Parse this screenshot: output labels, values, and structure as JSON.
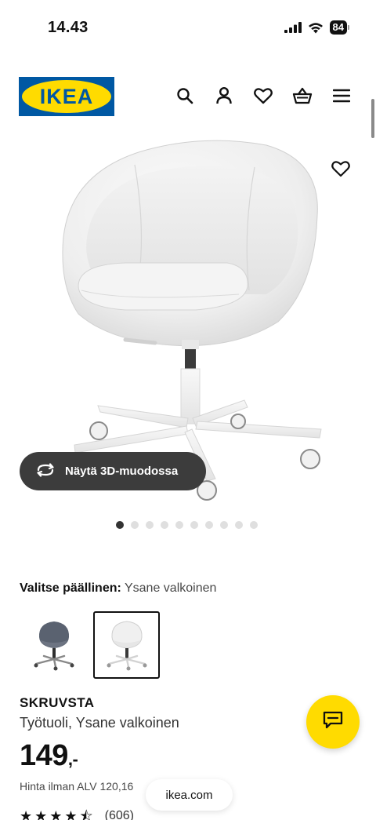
{
  "status_bar": {
    "time": "14.43",
    "battery": "84"
  },
  "header": {
    "logo_text": "IKEA",
    "icons": [
      "search-icon",
      "user-icon",
      "heart-icon",
      "basket-icon",
      "menu-icon"
    ]
  },
  "gallery": {
    "view_3d_label": "Näytä 3D-muodossa",
    "image_count": 10,
    "active_index": 0
  },
  "cover": {
    "label": "Valitse päällinen:",
    "value": "Ysane valkoinen",
    "options": [
      "grey",
      "white"
    ],
    "selected_index": 1
  },
  "product": {
    "name": "SKRUVSTA",
    "description": "Työtuoli, Ysane valkoinen",
    "price": "149",
    "price_suffix": ",-",
    "price_note": "Hinta ilman ALV 120,16",
    "rating_stars": 4.5,
    "review_count": "(606)"
  },
  "browser": {
    "url": "ikea.com"
  },
  "colors": {
    "brand_blue": "#0058a3",
    "brand_yellow": "#ffdb00",
    "chat_fab": "#ffdb00"
  }
}
